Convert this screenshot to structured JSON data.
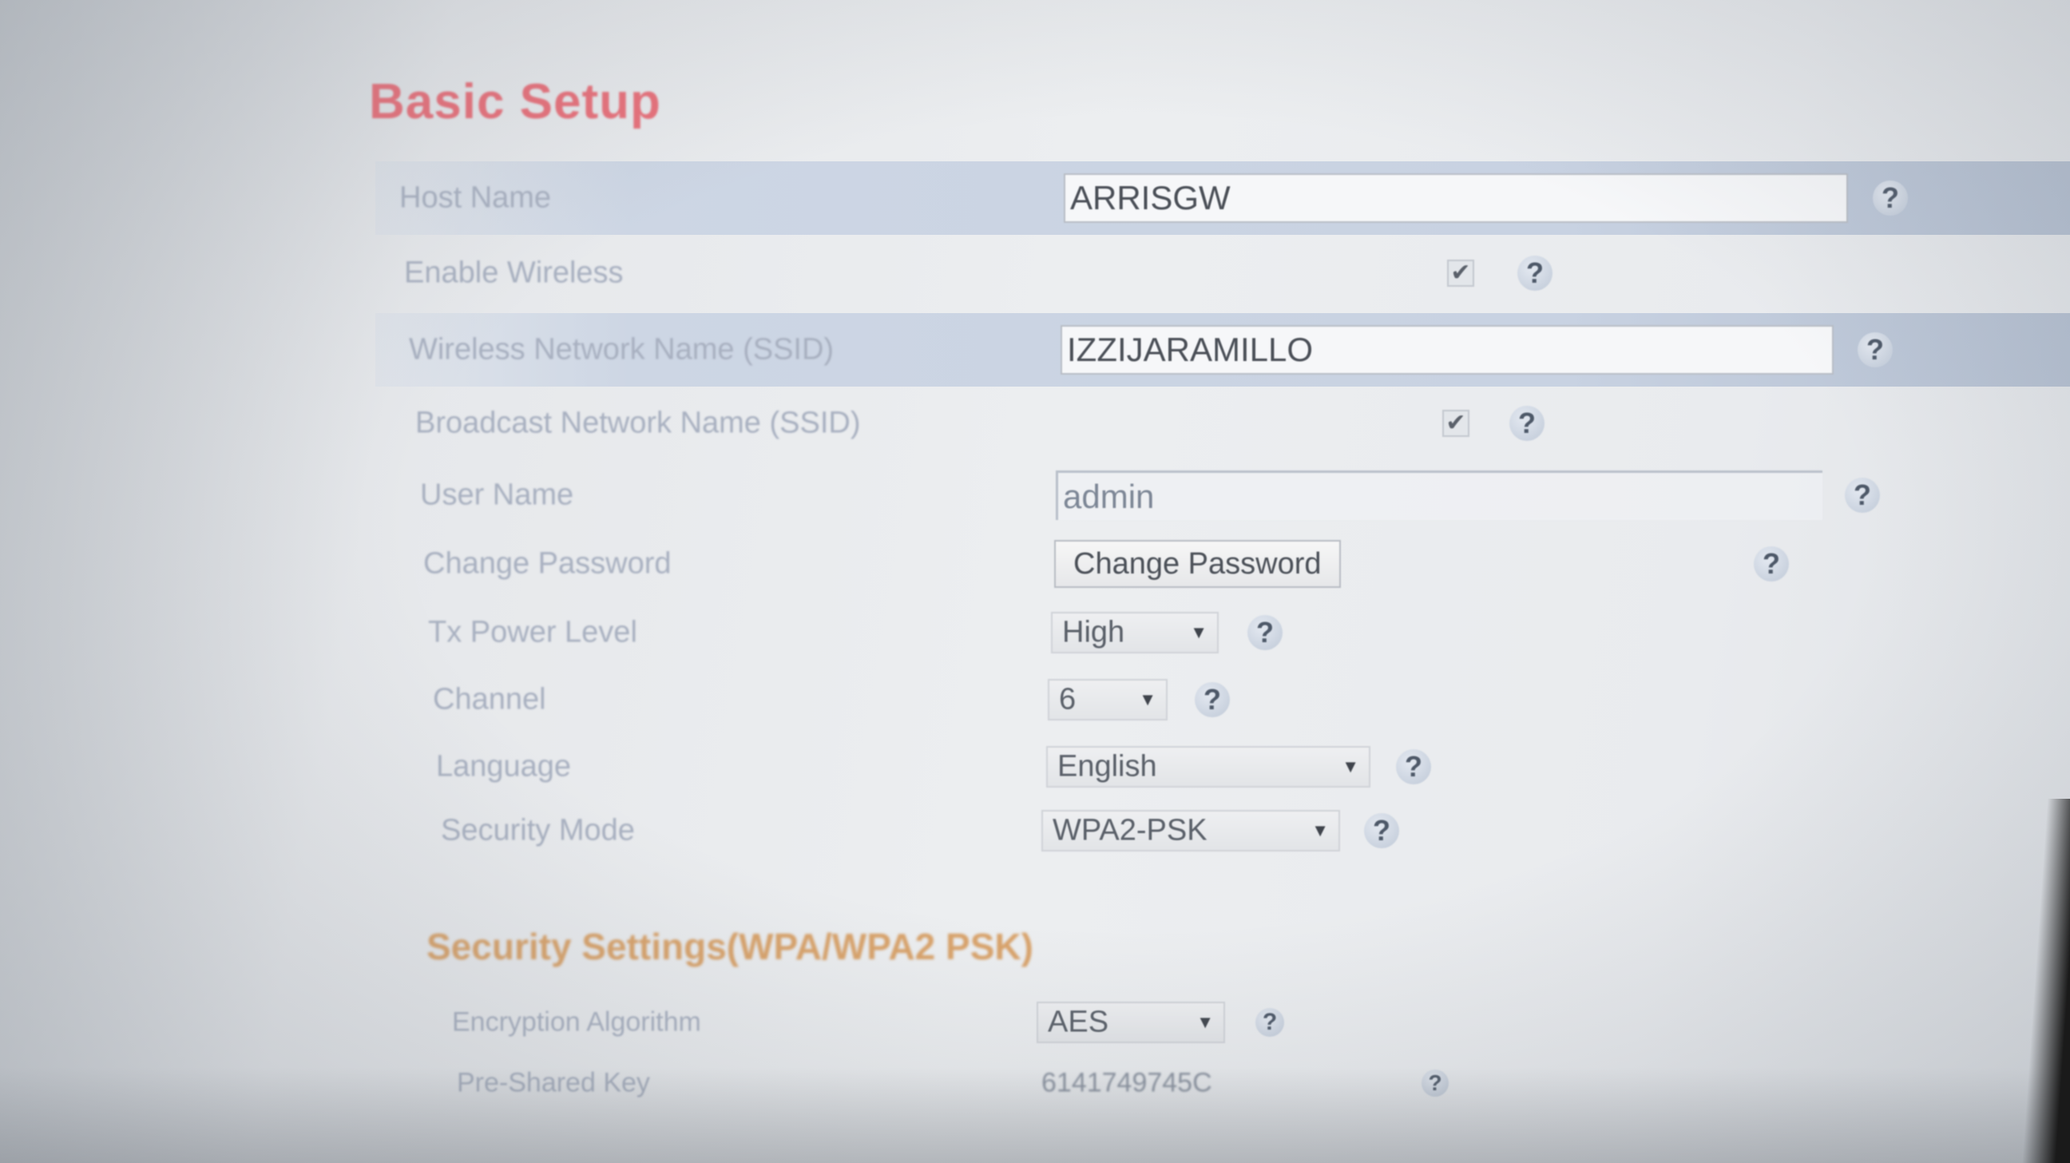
{
  "page": {
    "title": "Basic Setup"
  },
  "rows": {
    "host_name": {
      "label": "Host Name",
      "value": "ARRISGW"
    },
    "enable_wireless": {
      "label": "Enable Wireless",
      "checked": true
    },
    "ssid": {
      "label": "Wireless Network Name (SSID)",
      "value": "IZZIJARAMILLO"
    },
    "broadcast_ssid": {
      "label": "Broadcast Network Name (SSID)",
      "checked": true
    },
    "user_name": {
      "label": "User Name",
      "value": "admin"
    },
    "change_password": {
      "label": "Change Password",
      "button_label": "Change Password"
    },
    "tx_power": {
      "label": "Tx Power Level",
      "selected": "High"
    },
    "channel": {
      "label": "Channel",
      "selected": "6"
    },
    "language": {
      "label": "Language",
      "selected": "English"
    },
    "security_mode": {
      "label": "Security Mode",
      "selected": "WPA2-PSK"
    }
  },
  "security_section": {
    "title": "Security Settings(WPA/WPA2 PSK)",
    "encryption": {
      "label": "Encryption Algorithm",
      "selected": "AES"
    },
    "psk": {
      "label": "Pre-Shared Key",
      "value": "6141749745C"
    }
  },
  "help": {
    "glyph": "?"
  },
  "checkmark": "✔",
  "chevron": "▼",
  "colors": {
    "title": "#e8707a",
    "section_title": "#d8a26a",
    "row_shade": "#cdd6e4",
    "label": "#a8b0c0"
  }
}
